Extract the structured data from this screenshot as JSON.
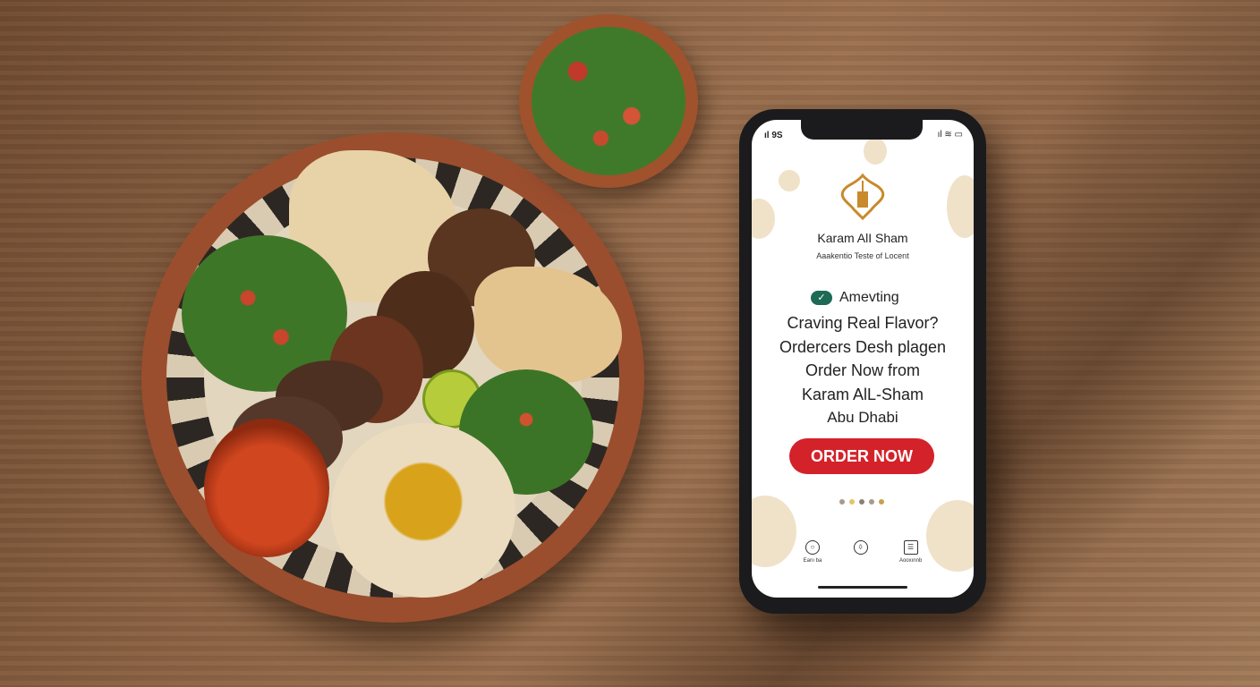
{
  "app": {
    "status_left": "ıl 9S",
    "status_right": "ıl ≋ ▭",
    "brand_name": "Karam AlI Sham",
    "tagline": "Aaakentio Teste of Locent",
    "badge_label": "Amevting",
    "headline_lines": [
      "Craving Real Flavor?",
      "Ordercers Desh plagen",
      "Order Now from",
      "Karam AlL-Sham",
      "Abu Dhabi"
    ],
    "order_button": "ORDER NOW",
    "nav": [
      {
        "label": "Eanı ba",
        "icon": "circle-icon"
      },
      {
        "label": "",
        "icon": "location-pin-icon"
      },
      {
        "label": "Aooxınnb",
        "icon": "menu-grid-icon"
      }
    ],
    "colors": {
      "accent": "#d3222a",
      "brand_gold": "#c98a2b",
      "check_green": "#1d6a55"
    }
  }
}
